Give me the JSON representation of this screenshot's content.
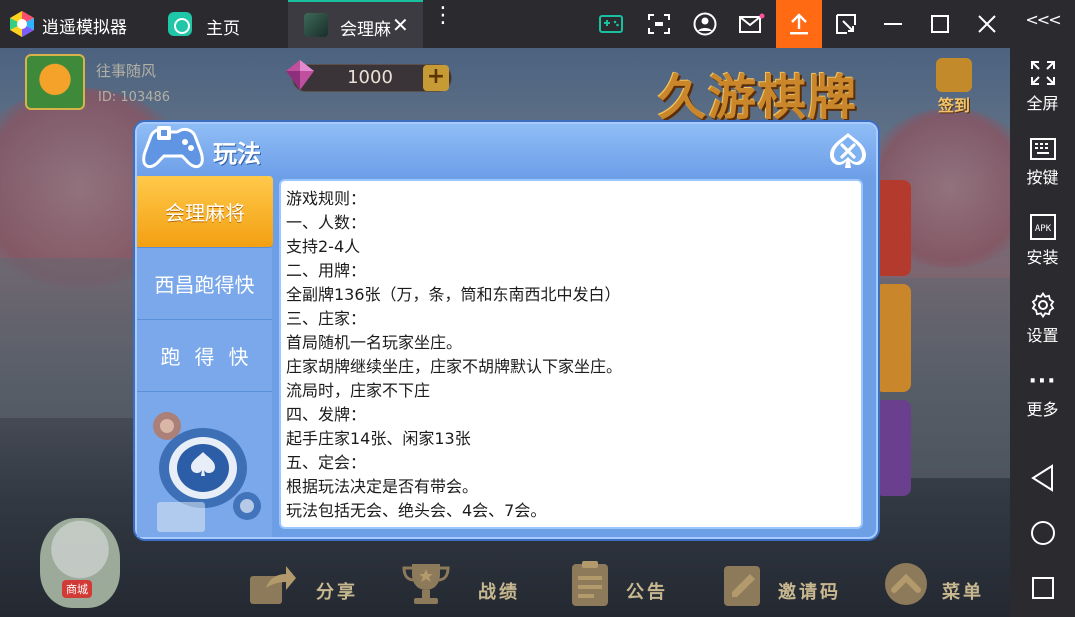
{
  "emulator": {
    "app_name": "逍遥模拟器",
    "home_tab_label": "主页",
    "game_tab_label": "会理麻",
    "game_tab_close": "✕",
    "menu_glyph": "⋮",
    "accent_color": "#ff6a13"
  },
  "sidebar": {
    "collapse_label": "<<<",
    "items": [
      {
        "label": "全屏",
        "icon": "fullscreen-icon"
      },
      {
        "label": "按键",
        "icon": "keyboard-icon"
      },
      {
        "label": "安装",
        "icon": "apk-icon"
      },
      {
        "label": "设置",
        "icon": "gear-icon"
      },
      {
        "label": "更多",
        "icon": "more-icon"
      }
    ],
    "apk_text": "APK",
    "more_dots": "···"
  },
  "player": {
    "name": "往事随风",
    "id": "ID: 103486"
  },
  "currency": {
    "gems": "1000",
    "plus": "+"
  },
  "game_logo": "久游棋牌",
  "signin_label": "签到",
  "shop_badge": "商城",
  "bottom_bar": [
    {
      "label": "分享",
      "icon": "share-icon"
    },
    {
      "label": "战绩",
      "icon": "trophy-icon"
    },
    {
      "label": "公告",
      "icon": "notice-icon"
    },
    {
      "label": "邀请码",
      "icon": "invite-icon"
    },
    {
      "label": "菜单",
      "icon": "menu-up-icon"
    }
  ],
  "dialog": {
    "title": "玩法",
    "tabs": [
      "会理麻将",
      "西昌跑得快",
      "跑得快"
    ],
    "active_tab": 0,
    "rules": [
      "游戏规则：",
      "一、人数：",
      "支持2-4人",
      "二、用牌：",
      "全副牌136张（万，条，筒和东南西北中发白）",
      "三、庄家：",
      "首局随机一名玩家坐庄。",
      "庄家胡牌继续坐庄，庄家不胡牌默认下家坐庄。",
      "流局时，庄家不下庄",
      "四、发牌：",
      "起手庄家14张、闲家13张",
      "五、定会：",
      "根据玩法决定是否有带会。",
      "玩法包括无会、绝头会、4会、7会。"
    ]
  }
}
